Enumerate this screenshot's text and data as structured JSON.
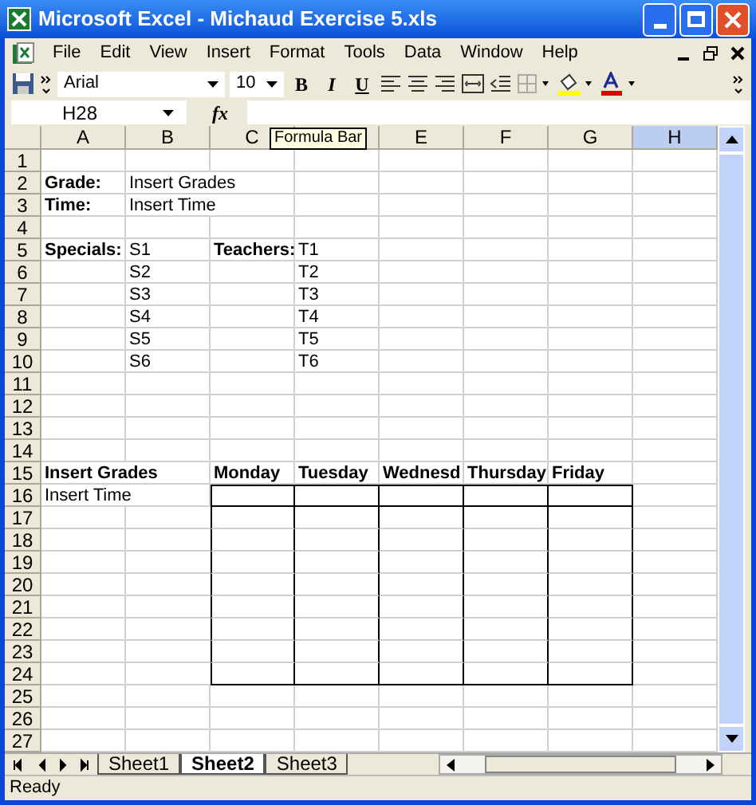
{
  "window": {
    "title": "Microsoft Excel - Michaud Exercise 5.xls"
  },
  "menu": [
    "File",
    "Edit",
    "View",
    "Insert",
    "Format",
    "Tools",
    "Data",
    "Window",
    "Help"
  ],
  "toolbar": {
    "font": "Arial",
    "size": "10",
    "bold": "B",
    "italic": "I",
    "underline": "U"
  },
  "formula_bar": {
    "name_box": "H28",
    "fx": "fx",
    "tooltip": "Formula Bar"
  },
  "columns": [
    {
      "label": "A",
      "selected": false
    },
    {
      "label": "B",
      "selected": false
    },
    {
      "label": "C",
      "selected": false
    },
    {
      "selected": false
    },
    {
      "label": "E",
      "selected": false
    },
    {
      "label": "F",
      "selected": false
    },
    {
      "label": "G",
      "selected": false
    },
    {
      "label": "H",
      "selected": true
    }
  ],
  "rows": [
    {
      "number": "1"
    },
    {
      "number": "2",
      "cells": {
        "A": {
          "text": "Grade:",
          "bold": true
        },
        "B": {
          "text": "Insert Grades",
          "bold": false
        }
      }
    },
    {
      "number": "3",
      "cells": {
        "A": {
          "text": "Time:",
          "bold": true
        },
        "B": {
          "text": "Insert Time",
          "bold": false
        }
      }
    },
    {
      "number": "4"
    },
    {
      "number": "5",
      "cells": {
        "A": {
          "text": "Specials:",
          "bold": true
        },
        "B": {
          "text": "S1",
          "bold": false
        },
        "C": {
          "text": "Teachers:",
          "bold": true
        },
        "D": {
          "text": "T1",
          "bold": false
        }
      }
    },
    {
      "number": "6",
      "cells": {
        "B": {
          "text": "S2",
          "bold": false
        },
        "D": {
          "text": "T2",
          "bold": false
        }
      }
    },
    {
      "number": "7",
      "cells": {
        "B": {
          "text": "S3",
          "bold": false
        },
        "D": {
          "text": "T3",
          "bold": false
        }
      }
    },
    {
      "number": "8",
      "cells": {
        "B": {
          "text": "S4",
          "bold": false
        },
        "D": {
          "text": "T4",
          "bold": false
        }
      }
    },
    {
      "number": "9",
      "cells": {
        "B": {
          "text": "S5",
          "bold": false
        },
        "D": {
          "text": "T5",
          "bold": false
        }
      }
    },
    {
      "number": "10",
      "cells": {
        "B": {
          "text": "S6",
          "bold": false
        },
        "D": {
          "text": "T6",
          "bold": false
        }
      }
    },
    {
      "number": "11"
    },
    {
      "number": "12"
    },
    {
      "number": "13"
    },
    {
      "number": "14"
    },
    {
      "number": "15",
      "cells": {
        "A": {
          "text": "Insert Grades",
          "bold": true
        },
        "C": {
          "text": "Monday",
          "bold": true
        },
        "D": {
          "text": "Tuesday",
          "bold": true
        },
        "E": {
          "text": "Wednesd",
          "bold": true
        },
        "F": {
          "text": "Thursday",
          "bold": true
        },
        "G": {
          "text": "Friday",
          "bold": true
        }
      }
    },
    {
      "number": "16",
      "bordered": true,
      "bottom_border": true,
      "cells": {
        "A": {
          "text": "Insert Time",
          "bold": false
        }
      }
    },
    {
      "number": "17",
      "bordered": true,
      "bottom_border": false
    },
    {
      "number": "18",
      "bordered": true,
      "bottom_border": false
    },
    {
      "number": "19",
      "bordered": true,
      "bottom_border": false
    },
    {
      "number": "20",
      "bordered": true,
      "bottom_border": false
    },
    {
      "number": "21",
      "bordered": true,
      "bottom_border": false
    },
    {
      "number": "22",
      "bordered": true,
      "bottom_border": false
    },
    {
      "number": "23",
      "bordered": true,
      "bottom_border": false
    },
    {
      "number": "24",
      "bordered": true,
      "bottom_border": true
    },
    {
      "number": "25"
    },
    {
      "number": "26"
    },
    {
      "number": "27"
    }
  ],
  "sheet_tabs": [
    {
      "label": "Sheet1",
      "selected": false
    },
    {
      "label": "Sheet2",
      "selected": true
    },
    {
      "label": "Sheet3",
      "selected": false
    }
  ],
  "status_bar": "Ready"
}
